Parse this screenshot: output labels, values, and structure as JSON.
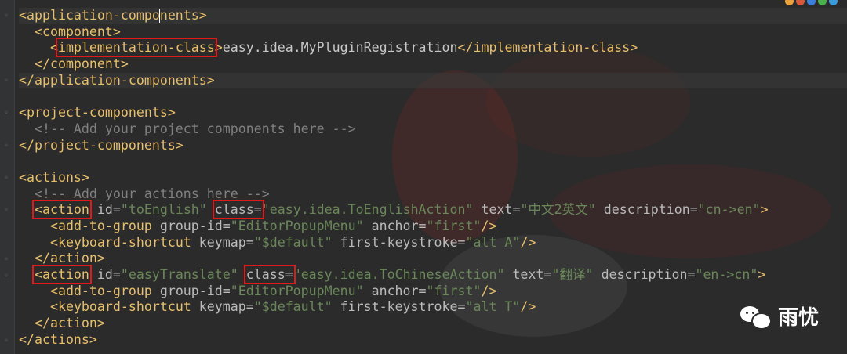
{
  "colors": {
    "background": "#2b2b2b",
    "tag": "#e8bf6a",
    "attribute_value": "#6a8759",
    "comment": "#808080",
    "highlight_box": "#e0191b"
  },
  "code": {
    "l1": {
      "open": "<application-compo",
      "open2": "nents>"
    },
    "l2": {
      "tag": "<component>"
    },
    "l3": {
      "lt": "<",
      "tag": "implementation-class",
      "gt": ">",
      "text": "easy.idea.MyPluginRegistration",
      "close": "</implementation-class>"
    },
    "l4": {
      "tag": "</component>"
    },
    "l5": {
      "tag": "</application-components>"
    },
    "l7": {
      "tag": "<project-components>"
    },
    "l8": {
      "comment": "<!-- Add your project components here -->"
    },
    "l9": {
      "tag": "</project-components>"
    },
    "l11": {
      "tag": "<actions>"
    },
    "l12": {
      "comment": "<!-- Add your actions here -->"
    },
    "l13": {
      "tag": "<action",
      "a1": " id=",
      "v1": "\"toEnglish\"",
      "a2": "class=",
      "v2": "\"easy.idea.ToEnglishAction\"",
      "a3": " text=",
      "v3": "\"中文2英文\"",
      "a4": " description=",
      "v4": "\"cn->en\"",
      "end": ">"
    },
    "l14": {
      "tag": "<add-to-group",
      "a1": " group-id=",
      "v1": "\"EditorPopupMenu\"",
      "a2": " anchor=",
      "v2": "\"first\"",
      "end": "/>"
    },
    "l15": {
      "tag": "<keyboard-shortcut",
      "a1": " keymap=",
      "v1": "\"$default\"",
      "a2": " first-keystroke=",
      "v2": "\"alt A\"",
      "end": "/>"
    },
    "l16": {
      "tag": "</action>"
    },
    "l17": {
      "tag": "<action",
      "a1": " id=",
      "v1": "\"easyTranslate\"",
      "a2": "class=",
      "v2": "\"easy.idea.ToChineseAction\"",
      "a3": " text=",
      "v3": "\"翻译\"",
      "a4": " description=",
      "v4": "\"en->cn\"",
      "end": ">"
    },
    "l18": {
      "tag": "<add-to-group",
      "a1": " group-id=",
      "v1": "\"EditorPopupMenu\"",
      "a2": " anchor=",
      "v2": "\"first\"",
      "end": "/>"
    },
    "l19": {
      "tag": "<keyboard-shortcut",
      "a1": " keymap=",
      "v1": "\"$default\"",
      "a2": " first-keystroke=",
      "v2": "\"alt T\"",
      "end": "/>"
    },
    "l20": {
      "tag": "</action>"
    },
    "l21": {
      "tag": "</actions>"
    }
  },
  "watermark": {
    "label": "雨忧",
    "icon": "wechat-icon"
  }
}
